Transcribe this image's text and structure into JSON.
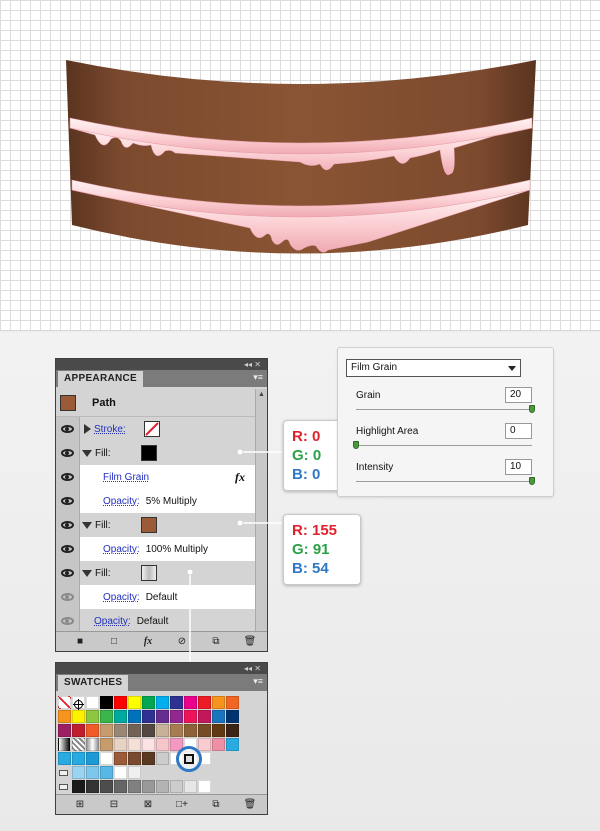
{
  "artwork": {
    "cake_color": "#7a4a30",
    "icing_color": "#fcd0d4"
  },
  "appearance_panel": {
    "window_controls": "◂◂ ✕",
    "tab_label": "APPEARANCE",
    "menu_icon": "▾≡",
    "header_label": "Path",
    "header_swatch_color": "#9b5b36",
    "rows": [
      {
        "label": "Stroke:",
        "value": "",
        "kind": "stroke"
      },
      {
        "label": "Fill:",
        "value": "",
        "kind": "fill",
        "color": "#000000"
      },
      {
        "label": "Film Grain",
        "value": "fx",
        "kind": "effect"
      },
      {
        "label": "Opacity:",
        "value": "5% Multiply",
        "kind": "opacity"
      },
      {
        "label": "Fill:",
        "value": "",
        "kind": "fill",
        "color": "#9b5b36"
      },
      {
        "label": "Opacity:",
        "value": "100% Multiply",
        "kind": "opacity"
      },
      {
        "label": "Fill:",
        "value": "",
        "kind": "fill",
        "color": "#cfcfcf"
      },
      {
        "label": "Opacity:",
        "value": "Default",
        "kind": "opacity"
      },
      {
        "label": "Opacity:",
        "value": "Default",
        "kind": "opacity-path"
      }
    ],
    "footer_icons": [
      "■",
      "□",
      "fx",
      "⊘",
      "⧉",
      "🗑"
    ]
  },
  "swatches_panel": {
    "window_controls": "◂◂ ✕",
    "tab_label": "SWATCHES",
    "menu_icon": "▾≡",
    "rows": [
      [
        "none",
        "register",
        "#ffffff",
        "#000000",
        "#ff0000",
        "#ffff00",
        "#00a651",
        "#00aeef",
        "#2e3192",
        "#ec008c",
        "#ed1c24",
        "#f7941d",
        "#f26522"
      ],
      [
        "#f7941d",
        "#fff200",
        "#8dc63f",
        "#39b54a",
        "#00a99d",
        "#0072bc",
        "#2e3192",
        "#662d91",
        "#92278f",
        "#ed145b",
        "#c2185b",
        "#1b75bc",
        "#003471"
      ],
      [
        "#9e1f63",
        "#be1e2d",
        "#f15a29",
        "#c69c6d",
        "#998675",
        "#736357",
        "#534741",
        "#c7b299",
        "#a67c52",
        "#8c6239",
        "#754c24",
        "#603913",
        "#3c2415"
      ],
      [
        "grad1",
        "grad2",
        "grad3",
        "#c69c6d",
        "#e7d3c4",
        "#f5e0d8",
        "#fbe3e4",
        "#f7c6ca",
        "#f49ac1",
        "#ffffff",
        "#fbcccf",
        "#ed8fa5",
        "#29abe2"
      ],
      [
        "#29abe2",
        "#27aae1",
        "#1b9ad6",
        "#ffffff",
        "#9b5b36",
        "#7a4a30",
        "#5b3a22",
        "#cccccc",
        "#ffffff",
        "#ffffff",
        "#ffffff",
        "",
        ""
      ],
      [
        "folder",
        "#9ad4f0",
        "#7ec7ec",
        "#58b8e5",
        "#ffffff",
        "#efefef",
        "",
        "",
        "",
        "",
        "",
        "",
        ""
      ],
      [
        "folder",
        "#1a1a1a",
        "#333333",
        "#4d4d4d",
        "#666666",
        "#808080",
        "#999999",
        "#b3b3b3",
        "#cccccc",
        "#e6e6e6",
        "#ffffff",
        "",
        ""
      ],
      [
        "folder",
        "#ed1c24",
        "#f7941d",
        "#fff200",
        "#00a651",
        "#0072bc",
        "#662d91",
        "",
        "",
        "",
        "",
        "",
        ""
      ]
    ],
    "footer_icons": [
      "⊞",
      "⊟",
      "⊠",
      "□+",
      "⧉",
      "🗑"
    ]
  },
  "readout_black": {
    "r": "R: 0",
    "g": "G: 0",
    "b": "B: 0"
  },
  "readout_brown": {
    "r": "R: 155",
    "g": "G: 91",
    "b": "B: 54"
  },
  "film_grain": {
    "effect_name": "Film Grain",
    "grain_label": "Grain",
    "grain_value": "20",
    "grain_fraction": 1.0,
    "highlight_label": "Highlight Area",
    "highlight_value": "0",
    "highlight_fraction": 0.0,
    "intensity_label": "Intensity",
    "intensity_value": "10",
    "intensity_fraction": 1.0
  }
}
